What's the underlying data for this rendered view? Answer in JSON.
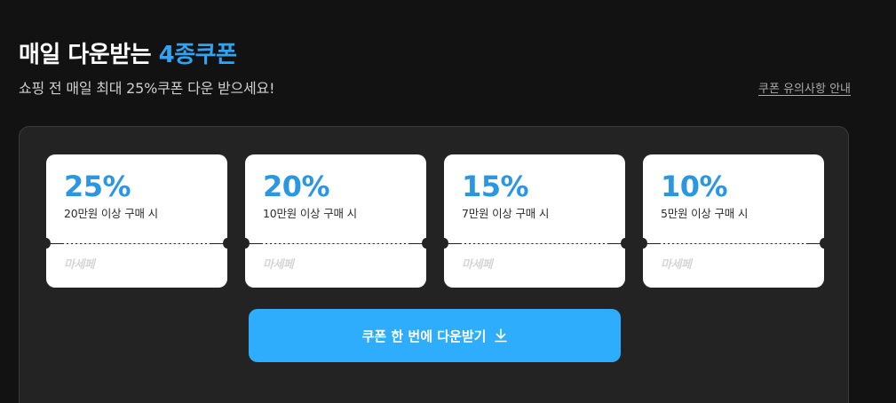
{
  "header": {
    "title_prefix": "매일 다운받는",
    "title_accent": "4종쿠폰",
    "subtitle": "쇼핑 전 매일 최대 25%쿠폰 다운 받으세요!",
    "notice_link": "쿠폰 유의사항 안내"
  },
  "coupons": [
    {
      "rate": "25%",
      "condition": "20만원 이상 구매 시",
      "brand": "마세페"
    },
    {
      "rate": "20%",
      "condition": "10만원 이상 구매 시",
      "brand": "마세페"
    },
    {
      "rate": "15%",
      "condition": "7만원 이상 구매 시",
      "brand": "마세페"
    },
    {
      "rate": "10%",
      "condition": "5만원 이상 구매 시",
      "brand": "마세페"
    }
  ],
  "download_button": {
    "label": "쿠폰 한 번에 다운받기",
    "icon": "download-icon"
  },
  "colors": {
    "accent": "#2fa5f7",
    "rate": "#2a97e3",
    "button": "#2dadfb",
    "background": "#121212",
    "panel": "#232323"
  }
}
